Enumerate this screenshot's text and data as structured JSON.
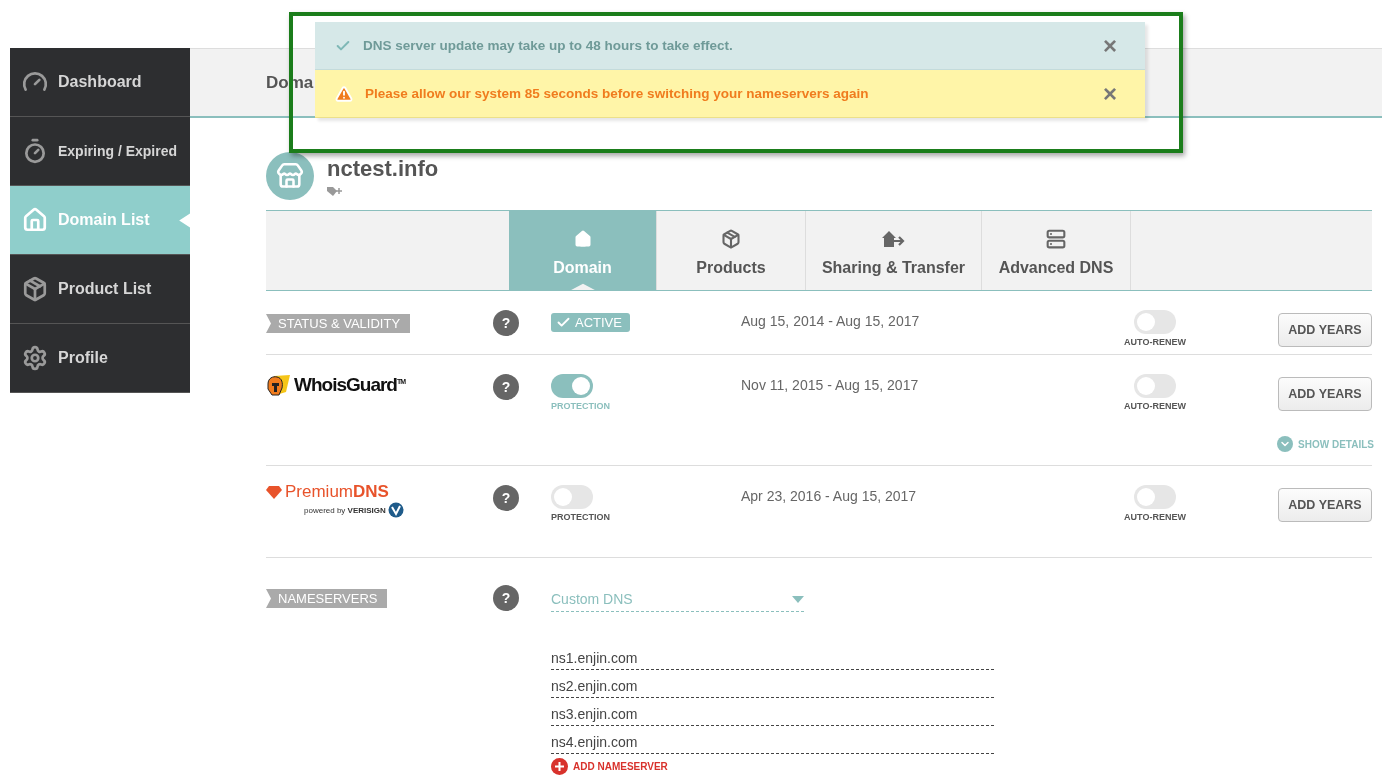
{
  "sidebar": {
    "items": [
      {
        "label": "Dashboard",
        "selected": false
      },
      {
        "label": "Expiring / Expired",
        "selected": false
      },
      {
        "label": "Domain List",
        "selected": true
      },
      {
        "label": "Product List",
        "selected": false
      },
      {
        "label": "Profile",
        "selected": false
      }
    ]
  },
  "header": {
    "title": "Doma"
  },
  "notifications": [
    {
      "kind": "info",
      "text": "DNS server update may take up to 48 hours to take effect.",
      "close": "×"
    },
    {
      "kind": "warning",
      "text": "Please allow our system 85 seconds before switching your nameservers again",
      "close": "×"
    }
  ],
  "domain": {
    "name": "nctest.info"
  },
  "tabs": [
    {
      "label": "Domain",
      "selected": true
    },
    {
      "label": "Products",
      "selected": false
    },
    {
      "label": "Sharing & Transfer",
      "selected": false
    },
    {
      "label": "Advanced DNS",
      "selected": false
    }
  ],
  "rows": [
    {
      "kind": "status",
      "label": "STATUS & VALIDITY",
      "help": "?",
      "badge": "ACTIVE",
      "dates": "Aug 15, 2014 - Aug 15, 2017",
      "auto_renew": {
        "label": "AUTO-RENEW",
        "on": false
      },
      "button": "ADD YEARS"
    },
    {
      "kind": "whoisguard",
      "logo": "WhoisGuard$^{TM}$",
      "help": "?",
      "protection": {
        "label": "PROTECTION",
        "on": true
      },
      "dates": "Nov 11, 2015 - Aug 15, 2017",
      "auto_renew": {
        "label": "AUTO-RENEW",
        "on": false
      },
      "button": "ADD YEARS",
      "details": "SHOW DETAILS"
    },
    {
      "kind": "premiumdns",
      "logo": "Premium**DNS**",
      "powered": "powered by **VERISIGN**",
      "help": "?",
      "protection": {
        "label": "PROTECTION",
        "on": false
      },
      "dates": "Apr 23, 2016 - Aug 15, 2017",
      "auto_renew": {
        "label": "AUTO-RENEW",
        "on": false
      },
      "button": "ADD YEARS"
    }
  ],
  "nameservers": {
    "label": "NAMESERVERS",
    "help": "?",
    "mode": "Custom DNS",
    "servers": [
      "ns1.enjin.com",
      "ns2.enjin.com",
      "ns3.enjin.com",
      "ns4.enjin.com"
    ],
    "add": "ADD NAMESERVER"
  }
}
